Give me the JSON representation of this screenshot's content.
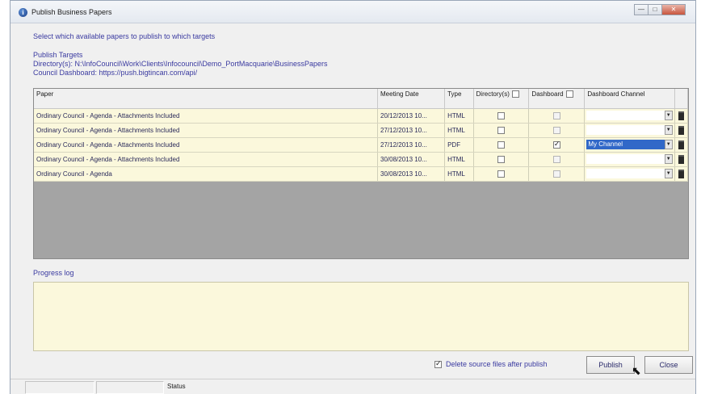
{
  "window": {
    "title": "Publish Business Papers",
    "controls": [
      "—",
      "□",
      "✕"
    ]
  },
  "instructions": "Select which available papers to publish to which targets",
  "targets": {
    "heading": "Publish Targets",
    "directory": "Directory(s): N:\\InfoCouncil\\Work\\Clients\\Infocouncil\\Demo_PortMacquarie\\BusinessPapers",
    "dashboard": "Council Dashboard: https://push.bigtincan.com/api/"
  },
  "table": {
    "headers": {
      "paper": "Paper",
      "meeting_date": "Meeting Date",
      "type": "Type",
      "directory": "Directory(s)",
      "dashboard": "Dashboard",
      "channel": "Dashboard Channel"
    },
    "rows": [
      {
        "paper": "Ordinary Council - Agenda - Attachments Included",
        "date": "20/12/2013 10...",
        "type": "HTML",
        "directory": false,
        "dashboard": false,
        "dashboard_enabled": false,
        "channel": ""
      },
      {
        "paper": "Ordinary Council - Agenda - Attachments Included",
        "date": "27/12/2013 10...",
        "type": "HTML",
        "directory": false,
        "dashboard": false,
        "dashboard_enabled": false,
        "channel": ""
      },
      {
        "paper": "Ordinary Council - Agenda - Attachments Included",
        "date": "27/12/2013 10...",
        "type": "PDF",
        "directory": false,
        "dashboard": true,
        "dashboard_enabled": true,
        "channel": "My Channel"
      },
      {
        "paper": "Ordinary Council - Agenda - Attachments Included",
        "date": "30/08/2013 10...",
        "type": "HTML",
        "directory": false,
        "dashboard": false,
        "dashboard_enabled": false,
        "channel": ""
      },
      {
        "paper": "Ordinary Council - Agenda",
        "date": "30/08/2013 10...",
        "type": "HTML",
        "directory": false,
        "dashboard": false,
        "dashboard_enabled": false,
        "channel": ""
      }
    ]
  },
  "progress": {
    "label": "Progress log"
  },
  "options": {
    "delete_source_label": "Delete source files after publish",
    "delete_source_checked": true
  },
  "buttons": {
    "publish": "Publish",
    "close": "Close"
  },
  "statusbar": {
    "status": "Status"
  }
}
